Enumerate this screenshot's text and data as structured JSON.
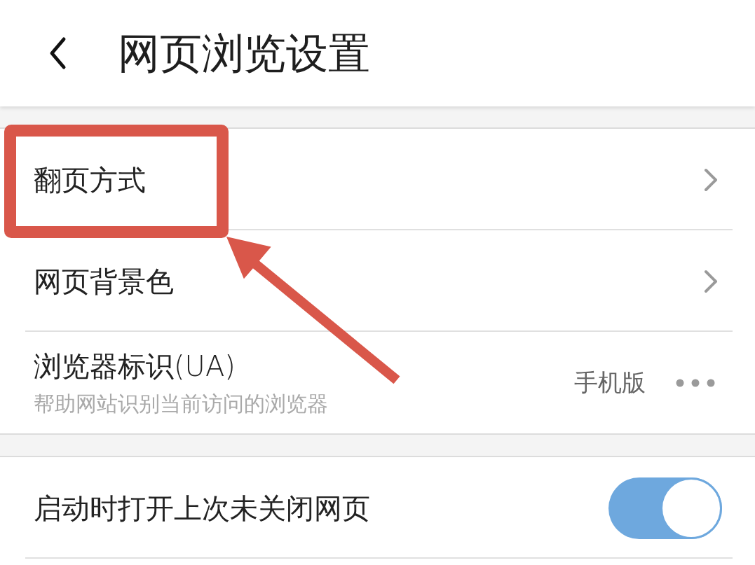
{
  "header": {
    "title": "网页浏览设置"
  },
  "sections": [
    {
      "rows": [
        {
          "kind": "link",
          "label": "翻页方式",
          "highlighted": true
        },
        {
          "kind": "link",
          "label": "网页背景色",
          "highlighted": false
        },
        {
          "kind": "option",
          "label": "浏览器标识(UA)",
          "subtitle": "帮助网站识别当前访问的浏览器",
          "value": "手机版",
          "highlighted": false
        }
      ]
    },
    {
      "rows": [
        {
          "kind": "toggle",
          "label": "启动时打开上次未关闭网页",
          "on": true,
          "highlighted": false
        }
      ]
    }
  ]
}
